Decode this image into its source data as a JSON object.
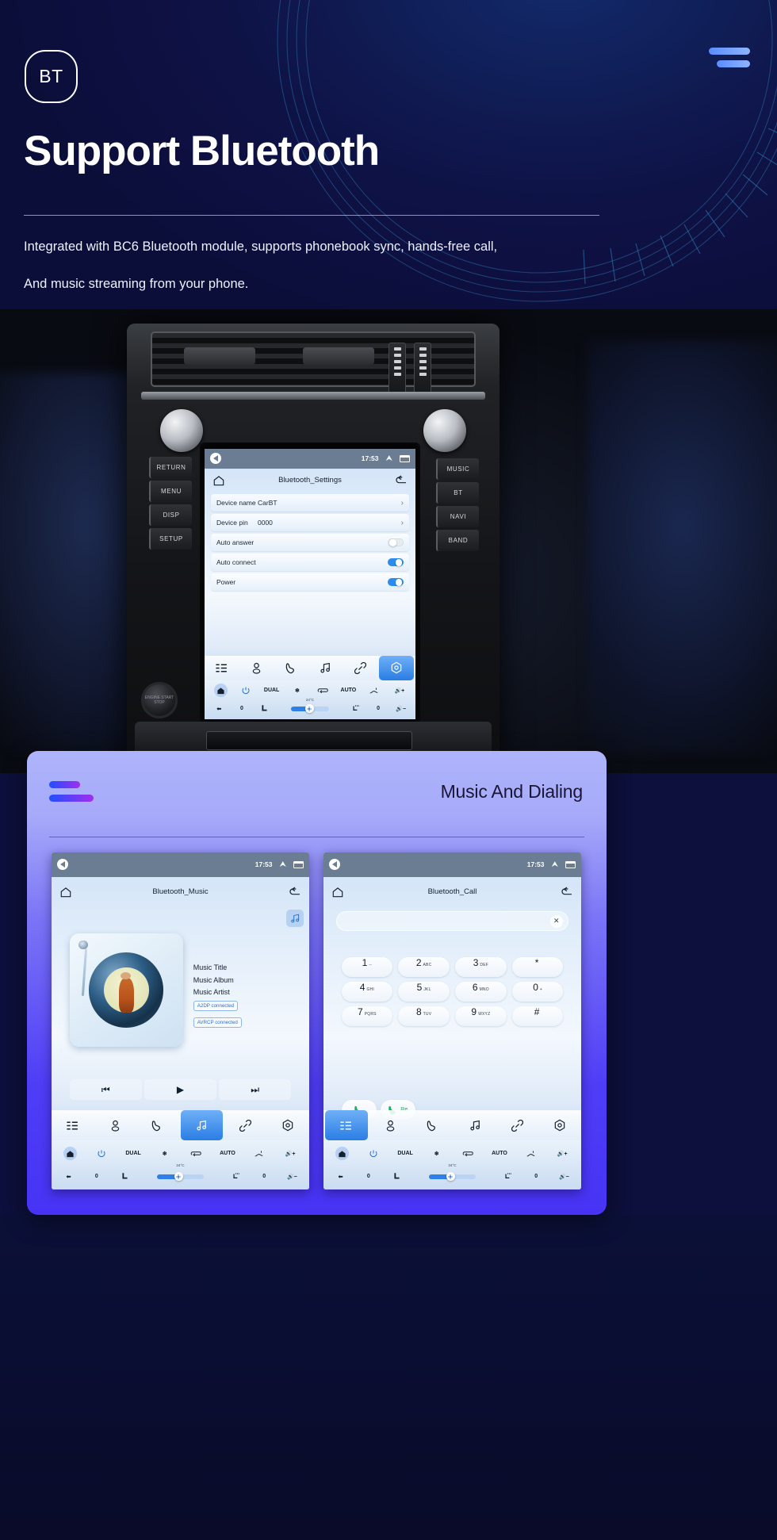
{
  "hero": {
    "badge": "BT",
    "title": "Support Bluetooth",
    "description_line1": "Integrated with BC6 Bluetooth module, supports phonebook sync, hands-free call,",
    "description_line2": "And music streaming from your phone.",
    "menu_icon": "hamburger-icon"
  },
  "car_unit": {
    "left_buttons": [
      "RETURN",
      "MENU",
      "DISP",
      "SETUP"
    ],
    "right_buttons": [
      "MUSIC",
      "BT",
      "NAVI",
      "BAND"
    ],
    "start_button": "ENGINE START STOP"
  },
  "screens": {
    "settings": {
      "status": {
        "time": "17:53",
        "up_icon": "chevron-up-icon",
        "window_icon": "recents-icon",
        "back_icon": "back-icon"
      },
      "title": "Bluetooth_Settings",
      "home_icon": "home-icon",
      "back_icon": "undo-icon",
      "rows": [
        {
          "label": "Device name",
          "value": "CarBT",
          "control": "chevron",
          "chevron": "›"
        },
        {
          "label": "Device pin",
          "value": "0000",
          "control": "chevron",
          "chevron": "›"
        },
        {
          "label": "Auto answer",
          "value": "",
          "control": "toggle",
          "on": false
        },
        {
          "label": "Auto connect",
          "value": "",
          "control": "toggle",
          "on": true
        },
        {
          "label": "Power",
          "value": "",
          "control": "toggle",
          "on": true
        }
      ],
      "dock": [
        {
          "icon": "apps-grid-icon",
          "active": false
        },
        {
          "icon": "contacts-icon",
          "active": false
        },
        {
          "icon": "phone-icon",
          "active": false
        },
        {
          "icon": "music-note-icon",
          "active": false
        },
        {
          "icon": "link-icon",
          "active": false
        },
        {
          "icon": "settings-hex-icon",
          "active": true
        }
      ]
    },
    "music": {
      "status": {
        "time": "17:53"
      },
      "title": "Bluetooth_Music",
      "music_button_icon": "music-note-icon",
      "track": {
        "title": "Music Title",
        "album": "Music Album",
        "artist": "Music Artist"
      },
      "badges": [
        "A2DP  connected",
        "AVRCP connected"
      ],
      "transport": [
        {
          "icon": "previous-track-icon",
          "glyph": "⏮"
        },
        {
          "icon": "play-icon",
          "glyph": "▶"
        },
        {
          "icon": "next-track-icon",
          "glyph": "⏭"
        }
      ],
      "dock_active_index": 3
    },
    "call": {
      "status": {
        "time": "17:53"
      },
      "title": "Bluetooth_Call",
      "number_value": "",
      "clear_icon": "close-icon",
      "keypad": [
        [
          {
            "big": "1",
            "sub": "--"
          },
          {
            "big": "2",
            "sub": "ABC"
          },
          {
            "big": "3",
            "sub": "DEF"
          },
          {
            "big": "*",
            "sub": ""
          }
        ],
        [
          {
            "big": "4",
            "sub": "GHI"
          },
          {
            "big": "5",
            "sub": "JKL"
          },
          {
            "big": "6",
            "sub": "MNO"
          },
          {
            "big": "0",
            "sub": "+"
          }
        ],
        [
          {
            "big": "7",
            "sub": "PQRS"
          },
          {
            "big": "8",
            "sub": "TUV"
          },
          {
            "big": "9",
            "sub": "WXYZ"
          },
          {
            "big": "#",
            "sub": ""
          }
        ]
      ],
      "call_button_icon": "call-icon",
      "redial_label": "Re",
      "dock_active_index": 0
    }
  },
  "climate": {
    "power_icon": "power-icon",
    "dual_label": "DUAL",
    "ac_icon": "snowflake-icon",
    "recirc_icon": "recirculate-icon",
    "auto_label": "AUTO",
    "defrost_icon": "defrost-icon",
    "vol_up_icon": "volume-up-icon",
    "vol_down_icon": "volume-down-icon",
    "temperature": "24°C",
    "left_temp": "0",
    "right_temp": "0",
    "seat_icon": "seat-icon",
    "seat_heat_icon": "seat-heat-icon",
    "fan_icon": "fan-icon",
    "home_icon": "home-icon",
    "back_icon": "back-arrow-icon"
  },
  "card": {
    "title": "Music And Dialing",
    "accent_gradient_start": "#1f4fff",
    "accent_gradient_end": "#a22df0",
    "background_start": "#aeb4fb",
    "background_end": "#4733f5"
  }
}
